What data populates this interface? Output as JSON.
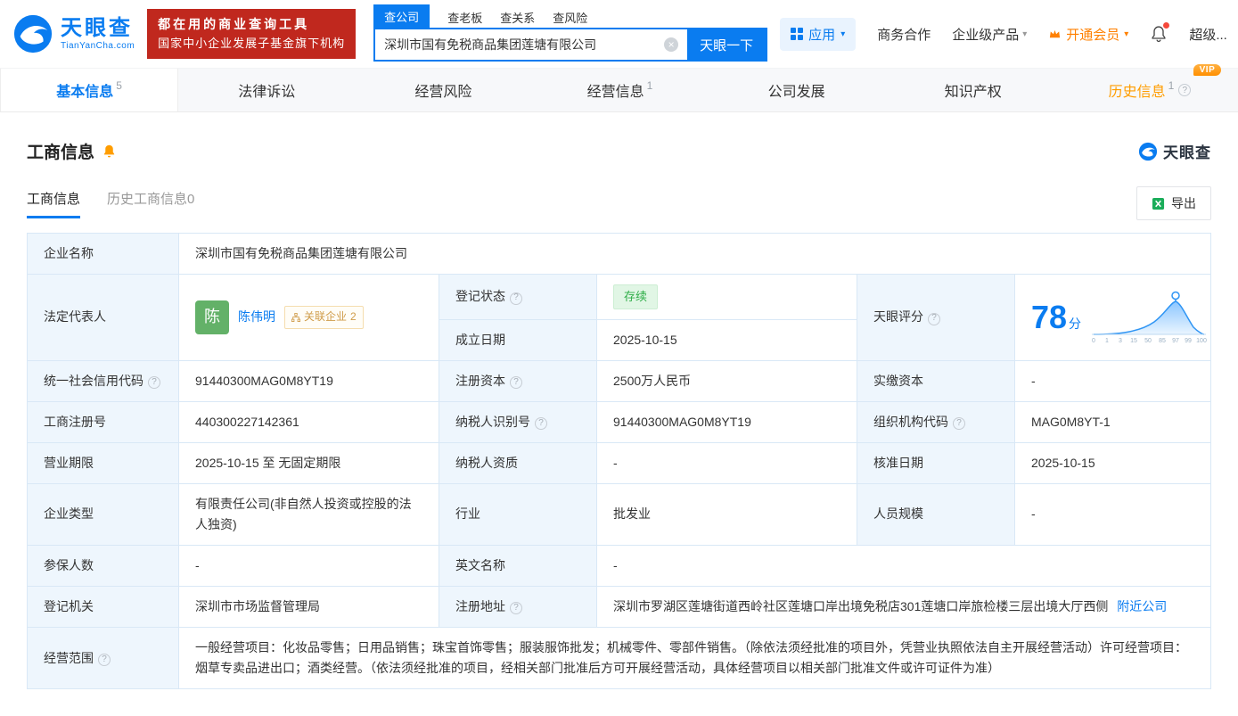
{
  "icons": {
    "caret": "▾",
    "clear": "×",
    "help": "?"
  },
  "colors": {
    "brand": "#0a7cf0",
    "vip_orange": "#ff9d00",
    "status_green": "#2fae48",
    "promo_red": "#c0281e"
  },
  "header": {
    "logo": {
      "brand": "天眼查",
      "domain": "TianYanCha.com"
    },
    "promo": {
      "line1": "都在用的商业查询工具",
      "line2": "国家中小企业发展子基金旗下机构"
    },
    "search_tabs": [
      {
        "label": "查公司"
      },
      {
        "label": "查老板"
      },
      {
        "label": "查关系"
      },
      {
        "label": "查风险"
      }
    ],
    "search": {
      "value": "深圳市国有免税商品集团莲塘有限公司",
      "button": "天眼一下"
    },
    "nav": {
      "apps": "应用",
      "cooperation": "商务合作",
      "enterprise": "企业级产品",
      "vip": "开通会员",
      "super": "超级..."
    }
  },
  "tabs": [
    {
      "label": "基本信息",
      "count": "5"
    },
    {
      "label": "法律诉讼",
      "count": ""
    },
    {
      "label": "经营风险",
      "count": ""
    },
    {
      "label": "经营信息",
      "count": "1"
    },
    {
      "label": "公司发展",
      "count": ""
    },
    {
      "label": "知识产权",
      "count": ""
    },
    {
      "label": "历史信息",
      "count": "1",
      "badge": "VIP"
    }
  ],
  "section": {
    "title": "工商信息",
    "watermark": "天眼查",
    "subtabs": [
      {
        "label": "工商信息"
      },
      {
        "label": "历史工商信息0"
      }
    ],
    "export_label": "导出"
  },
  "table": {
    "company_name": {
      "label": "企业名称",
      "value": "深圳市国有免税商品集团莲塘有限公司"
    },
    "legal_rep": {
      "label": "法定代表人",
      "avatar": "陈",
      "name": "陈伟明",
      "tag": "关联企业",
      "tag_count": "2"
    },
    "reg_status": {
      "label": "登记状态",
      "value": "存续"
    },
    "establish_date": {
      "label": "成立日期",
      "value": "2025-10-15"
    },
    "score": {
      "label": "天眼评分",
      "value": "78",
      "unit": "分",
      "axis": [
        "0",
        "1",
        "3",
        "15",
        "50",
        "85",
        "97",
        "99",
        "100"
      ]
    },
    "credit_code": {
      "label": "统一社会信用代码",
      "value": "91440300MAG0M8YT19"
    },
    "reg_capital": {
      "label": "注册资本",
      "value": "2500万人民币"
    },
    "paid_capital": {
      "label": "实缴资本",
      "value": "-"
    },
    "reg_number": {
      "label": "工商注册号",
      "value": "440300227142361"
    },
    "taxpayer_id": {
      "label": "纳税人识别号",
      "value": "91440300MAG0M8YT19"
    },
    "org_code": {
      "label": "组织机构代码",
      "value": "MAG0M8YT-1"
    },
    "business_term": {
      "label": "营业期限",
      "value": "2025-10-15 至 无固定期限"
    },
    "taxpayer_quality": {
      "label": "纳税人资质",
      "value": "-"
    },
    "approved_date": {
      "label": "核准日期",
      "value": "2025-10-15"
    },
    "company_type": {
      "label": "企业类型",
      "value": "有限责任公司(非自然人投资或控股的法人独资)"
    },
    "industry": {
      "label": "行业",
      "value": "批发业"
    },
    "staff_size": {
      "label": "人员规模",
      "value": "-"
    },
    "insured_count": {
      "label": "参保人数",
      "value": "-"
    },
    "english_name": {
      "label": "英文名称",
      "value": "-"
    },
    "reg_authority": {
      "label": "登记机关",
      "value": "深圳市市场监督管理局"
    },
    "reg_address": {
      "label": "注册地址",
      "value": "深圳市罗湖区莲塘街道西岭社区莲塘口岸出境免税店301莲塘口岸旅检楼三层出境大厅西侧",
      "link": "附近公司"
    },
    "business_scope": {
      "label": "经营范围",
      "value": "一般经营项目：化妆品零售；日用品销售；珠宝首饰零售；服装服饰批发；机械零件、零部件销售。（除依法须经批准的项目外，凭营业执照依法自主开展经营活动）许可经营项目：烟草专卖品进出口；酒类经营。（依法须经批准的项目，经相关部门批准后方可开展经营活动，具体经营项目以相关部门批准文件或许可证件为准）"
    }
  }
}
